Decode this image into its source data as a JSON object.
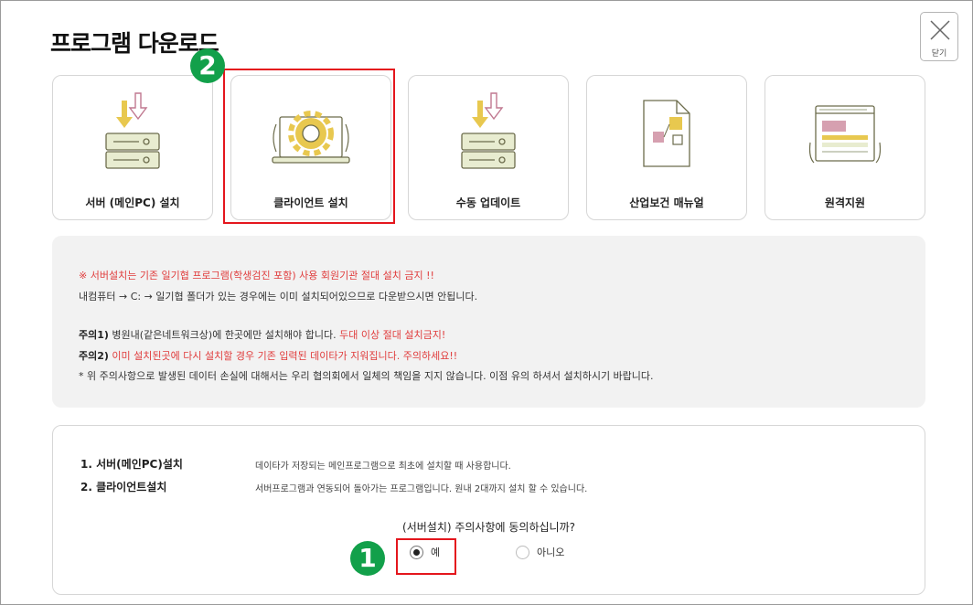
{
  "page": {
    "title": "프로그램 다운로드",
    "close_label": "닫기"
  },
  "cards": [
    {
      "label": "서버 (메인PC) 설치",
      "icon": "server-install-icon"
    },
    {
      "label": "클라이언트 설치",
      "icon": "client-install-icon"
    },
    {
      "label": "수동 업데이트",
      "icon": "manual-update-icon"
    },
    {
      "label": "산업보건 매뉴얼",
      "icon": "manual-document-icon"
    },
    {
      "label": "원격지원",
      "icon": "remote-support-icon"
    }
  ],
  "notice": {
    "line1_prefix": "※ ",
    "line1_red": "서버설치는 기존 일기협 프로그램(학생검진 포함) 사용 회원기관 절대 설치 금지 !!",
    "line2": "내컴퓨터 → C: → 일기협 폴더가 있는 경우에는 이미 설치되어있으므로 다운받으시면 안됩니다.",
    "caution1_label": "주의1)",
    "caution1_text": " 병원내(같은네트워크상)에 한곳에만 설치해야 합니다. ",
    "caution1_red": "두대 이상 절대 설치금지!",
    "caution2_label": "주의2)",
    "caution2_red": " 이미 설치된곳에 다시 설치할 경우 기존 입력된 데이타가 지워집니다. 주의하세요!!",
    "line5": "* 위 주의사항으로 발생된 데이터 손실에 대해서는 우리 협의회에서 일체의 책임을 지지 않습니다. 이점 유의 하셔서 설치하시기 바랍니다."
  },
  "info": {
    "item1_term": "1. 서버(메인PC)설치",
    "item1_desc": "데이타가 저장되는 메인프로그램으로 최초에 설치할 때 사용합니다.",
    "item2_term": "2. 클라이언트설치",
    "item2_desc": "서버프로그램과 연동되어 돌아가는 프로그램입니다. 원내 2대까지 설치 할 수 있습니다.",
    "question": "(서버설치) 주의사항에 동의하십니까?",
    "option_yes": "예",
    "option_no": "아니오",
    "selected": "예"
  },
  "annotations": {
    "badge1": "1",
    "badge2": "2",
    "highlight_color": "#e4161d",
    "badge_color": "#12a04a"
  },
  "colors": {
    "warning_red": "#e03c3c",
    "notice_bg": "#f2f2f2",
    "icon_green": "#e8ecd0",
    "icon_gold": "#e8c84f",
    "icon_pink": "#d6a0b0"
  }
}
